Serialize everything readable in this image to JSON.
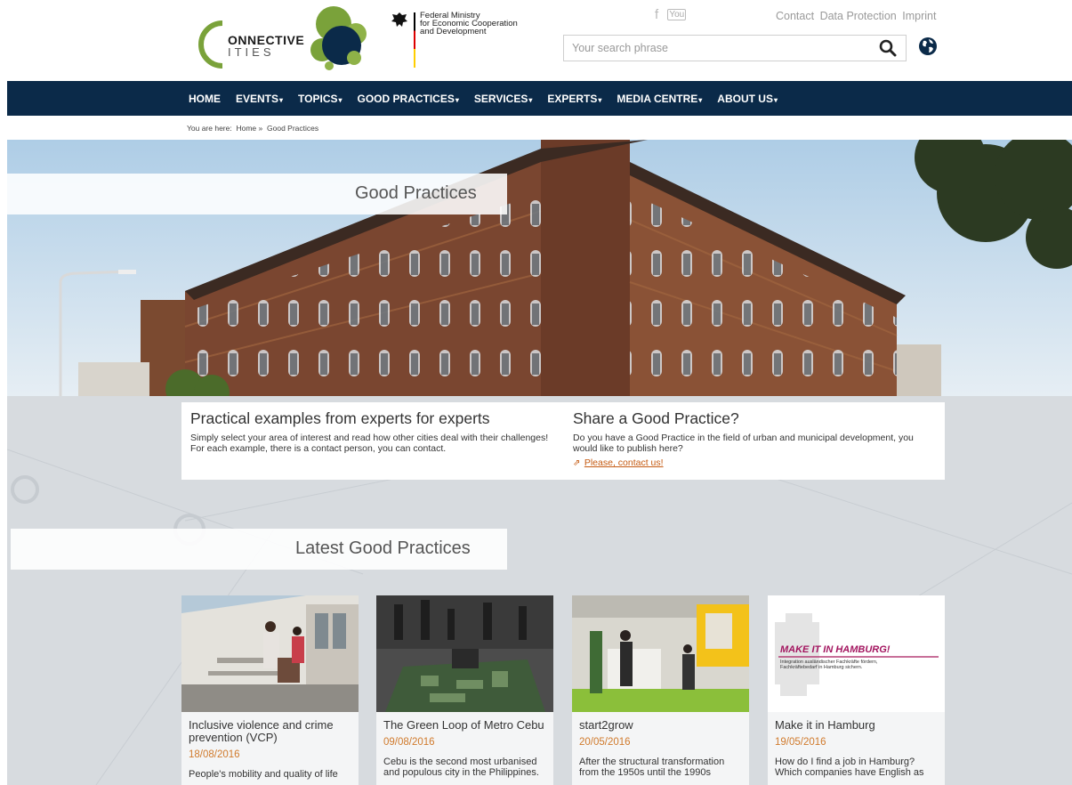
{
  "header": {
    "logo_line1": "ONNECTIVE",
    "logo_line2": "ITIES",
    "ministry": "Federal Ministry\nfor Economic Cooperation\nand Development",
    "social": {
      "facebook": "f",
      "youtube": "You"
    },
    "links": [
      "Contact",
      "Data Protection",
      "Imprint"
    ],
    "search_placeholder": "Your search phrase"
  },
  "nav": {
    "items": [
      {
        "label": "HOME",
        "dropdown": false
      },
      {
        "label": "EVENTS",
        "dropdown": true
      },
      {
        "label": "TOPICS",
        "dropdown": true
      },
      {
        "label": "GOOD PRACTICES",
        "dropdown": true
      },
      {
        "label": "SERVICES",
        "dropdown": true
      },
      {
        "label": "EXPERTS",
        "dropdown": true
      },
      {
        "label": "MEDIA CENTRE",
        "dropdown": true
      },
      {
        "label": "ABOUT US",
        "dropdown": true
      }
    ]
  },
  "breadcrumb": {
    "prefix": "You are here:",
    "home": "Home",
    "separator": "»",
    "current": "Good Practices"
  },
  "hero": {
    "title": "Good Practices"
  },
  "intro": {
    "left_title": "Practical examples from experts for experts",
    "left_text": "Simply select your area of interest and read how other cities deal with their challenges! For each example, there is a contact person, you can contact.",
    "right_title": "Share a Good Practice?",
    "right_text": "Do you have a Good Practice in the field of urban and municipal development, you would like to publish here?",
    "right_link": "Please, contact us!"
  },
  "latest": {
    "title": "Latest Good Practices",
    "cards": [
      {
        "title": "Inclusive violence and crime prevention (VCP)",
        "date": "18/08/2016",
        "excerpt": "People's mobility and quality of life"
      },
      {
        "title": "The Green Loop of Metro Cebu",
        "date": "09/08/2016",
        "excerpt": "Cebu is the second most urbanised and populous city in the Philippines."
      },
      {
        "title": "start2grow",
        "date": "20/05/2016",
        "excerpt": "After the structural transformation from the 1950s until the 1990s"
      },
      {
        "title": "Make it in Hamburg",
        "date": "19/05/2016",
        "excerpt": "How do I find a job in Hamburg? Which companies have English as",
        "image_headline": "MAKE IT IN HAMBURG!",
        "image_subline": "Integration ausländischer Fachkräfte fördern,\nFachkräftebedarf in Hamburg sichern."
      }
    ]
  },
  "colors": {
    "nav": "#0b2a49",
    "accent": "#d07a2c",
    "link": "#c55a11",
    "backdrop": "#d7dbdf"
  },
  "icons": [
    "facebook-icon",
    "youtube-icon",
    "search-icon",
    "globe-icon",
    "external-link-icon"
  ]
}
